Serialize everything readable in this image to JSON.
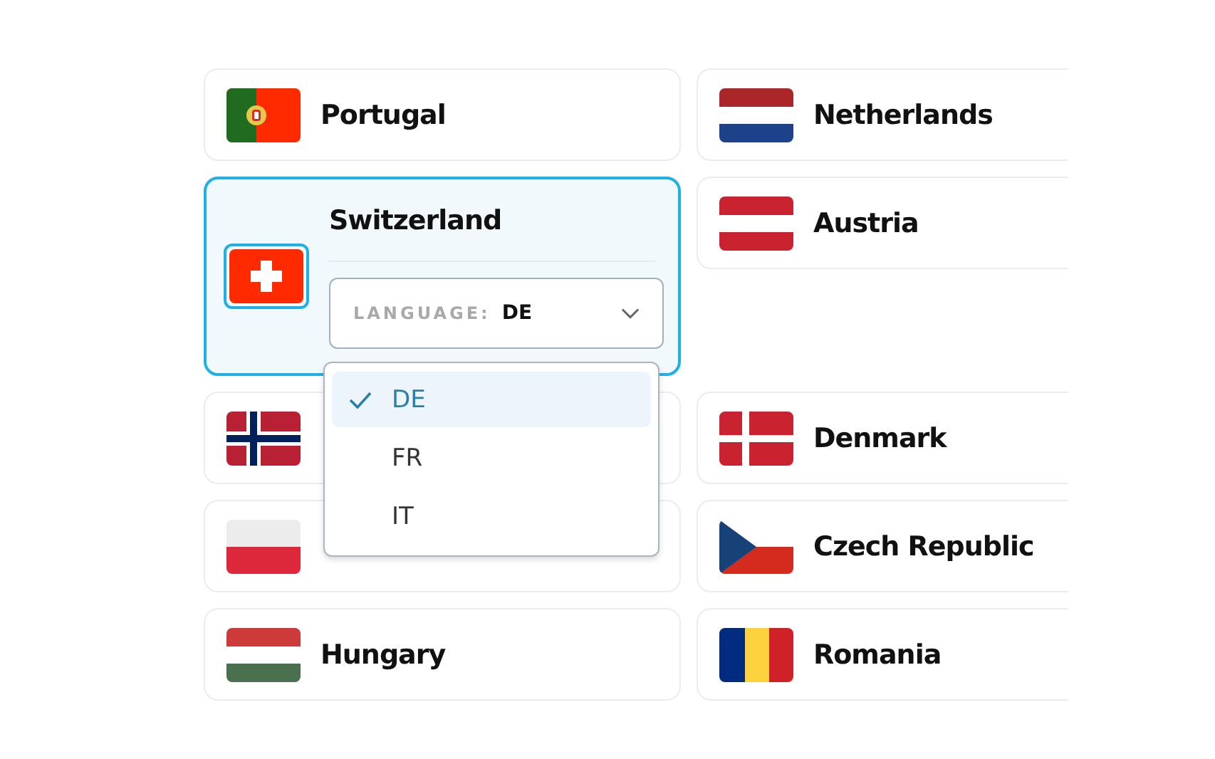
{
  "countries": [
    {
      "name": "Portugal",
      "kind": "portugal",
      "selected": false
    },
    {
      "name": "Netherlands",
      "kind": "netherlands",
      "selected": false
    },
    {
      "name": "Switzerland",
      "kind": "switzerland",
      "selected": true,
      "language": {
        "label": "LANGUAGE:",
        "value": "DE",
        "expanded": true,
        "options": [
          {
            "label": "DE",
            "selected": true
          },
          {
            "label": "FR",
            "selected": false
          },
          {
            "label": "IT",
            "selected": false
          }
        ]
      }
    },
    {
      "name": "Austria",
      "kind": "austria",
      "selected": false
    },
    {
      "kind": "norway",
      "selected": false
    },
    {
      "name": "Denmark",
      "kind": "denmark",
      "selected": false
    },
    {
      "kind": "poland",
      "selected": false
    },
    {
      "name": "Czech Republic",
      "kind": "czech",
      "selected": false
    },
    {
      "name": "Hungary",
      "kind": "hungary",
      "selected": false
    },
    {
      "name": "Romania",
      "kind": "romania",
      "selected": false
    }
  ]
}
